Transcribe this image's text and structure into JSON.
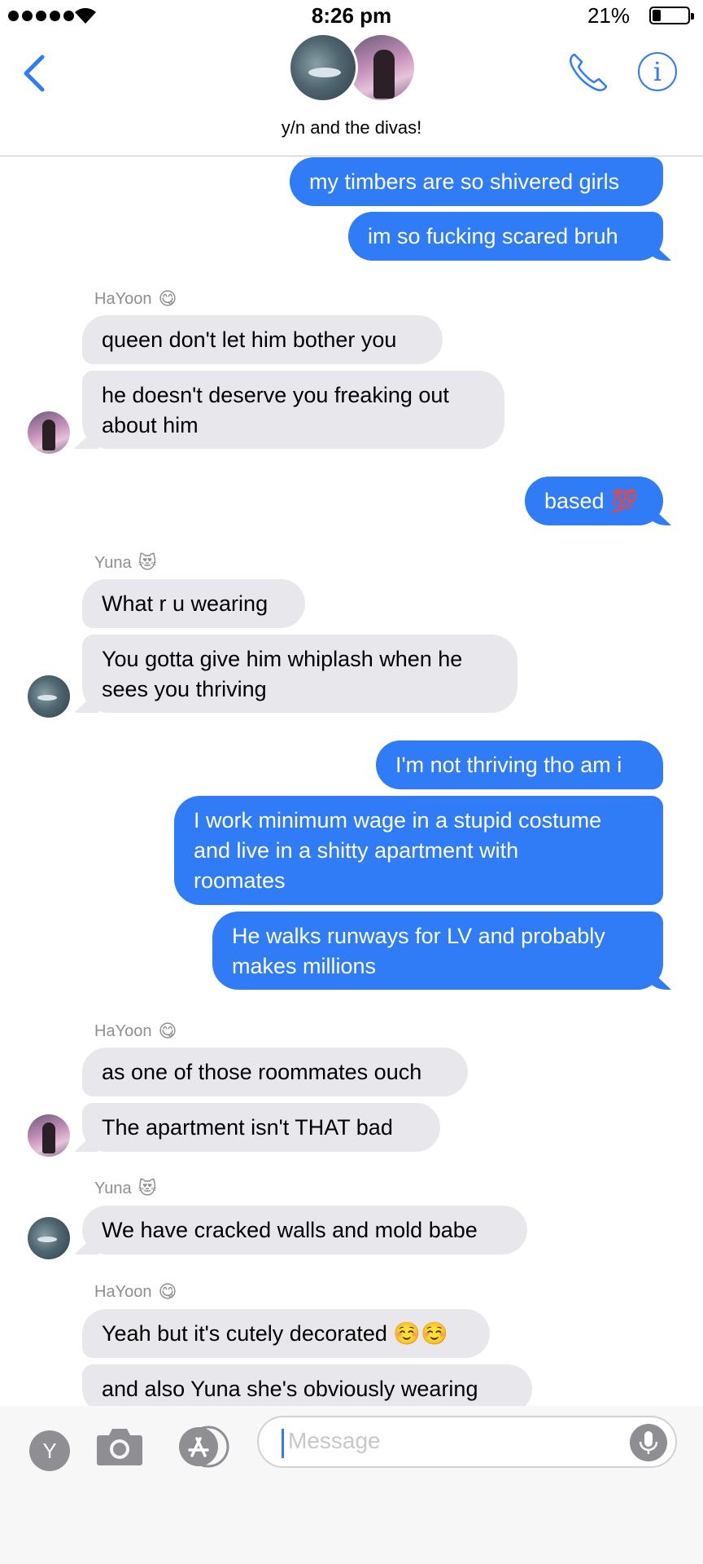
{
  "status_bar": {
    "time": "8:26 pm",
    "battery_percent": "21%",
    "battery_level": 0.21,
    "signal_bars": 5
  },
  "header": {
    "back_icon": "chevron-left-icon",
    "group_name": "y/n and the divas!",
    "call_icon": "phone-icon",
    "info_icon": "info-icon",
    "info_glyph": "i"
  },
  "messages": [
    {
      "dir": "out",
      "text": "my timbers are so shivered girls"
    },
    {
      "dir": "out",
      "text": "im so fucking scared bruh"
    },
    {
      "dir": "in",
      "sender": "HaYoon",
      "sender_emoji": "😋",
      "text": "queen don't let him bother you"
    },
    {
      "dir": "in",
      "text": "he doesn't deserve you freaking out about him",
      "line1": "he doesn't deserve you freaking out",
      "line2": "about him"
    },
    {
      "dir": "out",
      "text": "based",
      "emoji": "💯"
    },
    {
      "dir": "in",
      "sender": "Yuna",
      "sender_emoji": "😻",
      "text": "What r u wearing"
    },
    {
      "dir": "in",
      "text": "You gotta give him whiplash when he sees you thriving",
      "line1": "You gotta give him whiplash when he",
      "line2": "sees you thriving"
    },
    {
      "dir": "out",
      "text": "I'm not thriving tho am i"
    },
    {
      "dir": "out",
      "text": "I work minimum wage in a stupid costume and live in a shitty apartment with roomates",
      "line1": "I work minimum wage in a stupid costume",
      "line2": "and live in a shitty apartment with",
      "line3": "roomates"
    },
    {
      "dir": "out",
      "text": "He walks runways for LV and probably makes millions",
      "line1": "He walks runways for LV and probably",
      "line2": "makes millions"
    },
    {
      "dir": "in",
      "sender": "HaYoon",
      "sender_emoji": "😋",
      "text": "as one of those roommates ouch"
    },
    {
      "dir": "in",
      "text": "The apartment isn't THAT bad"
    },
    {
      "dir": "in",
      "sender": "Yuna",
      "sender_emoji": "😻",
      "text": "We have cracked walls and mold babe"
    },
    {
      "dir": "in",
      "sender": "HaYoon",
      "sender_emoji": "😋",
      "text": "Yeah but it's cutely decorated ☺️☺️"
    },
    {
      "dir": "in",
      "text": "and also Yuna she's obviously wearing"
    }
  ],
  "composer": {
    "y_label": "Y",
    "camera_icon": "camera-icon",
    "appstore_icon": "app-store-icon",
    "placeholder": "Message",
    "mic_icon": "microphone-icon"
  },
  "colors": {
    "accent": "#2f7cf6",
    "incoming_bubble": "#e8e8ec",
    "sender_name": "#8e8e93"
  }
}
